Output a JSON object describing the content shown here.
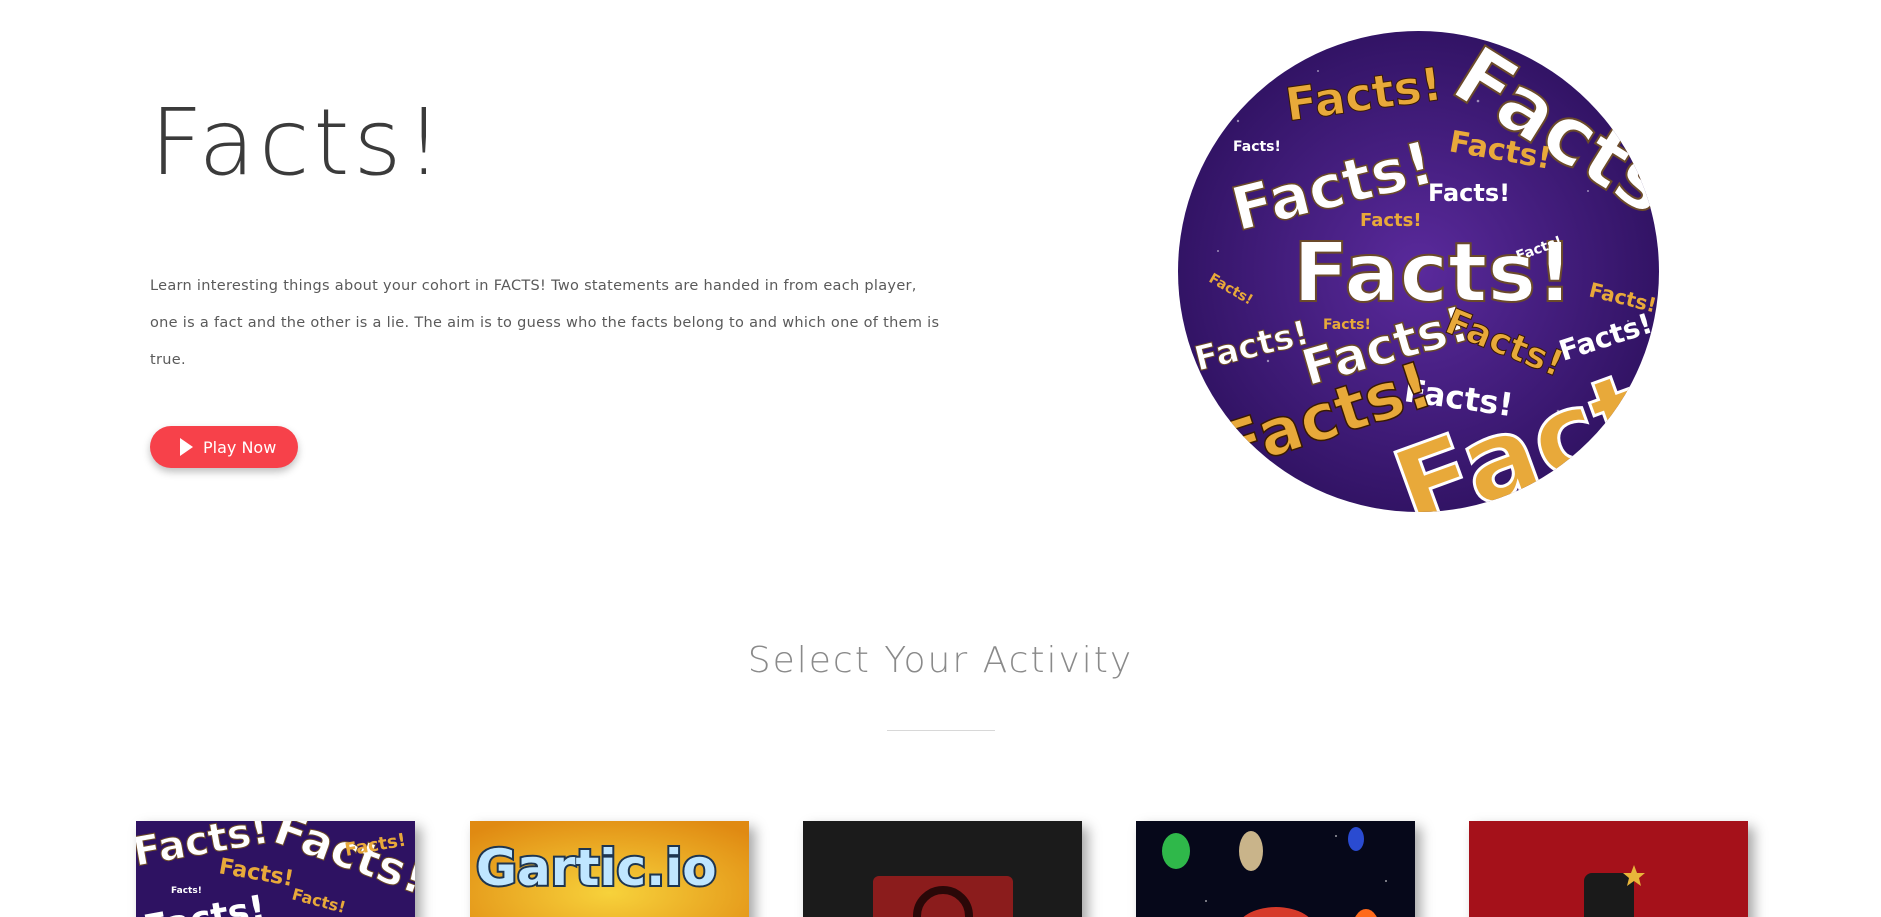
{
  "hero": {
    "title": "Facts!",
    "description": "Learn interesting things about your cohort in FACTS! Two statements are handed in from each player, one is a fact and the other is a lie. The aim is to guess who the facts belong to and which one of them is true.",
    "play_button_label": "Play Now",
    "image_text": "Facts!"
  },
  "activities": {
    "title": "Select Your Activity",
    "cards": [
      {
        "name": "facts",
        "text": "Facts!"
      },
      {
        "name": "gartic",
        "text": "Gartic.io"
      },
      {
        "name": "codenames",
        "text": ""
      },
      {
        "name": "among-us",
        "text": ""
      },
      {
        "name": "red-game",
        "text": ""
      }
    ]
  },
  "colors": {
    "accent": "#f7414a",
    "title": "#3b3b3b",
    "facts_purple": "#3a1a6e",
    "facts_gold": "#e8a93a"
  }
}
